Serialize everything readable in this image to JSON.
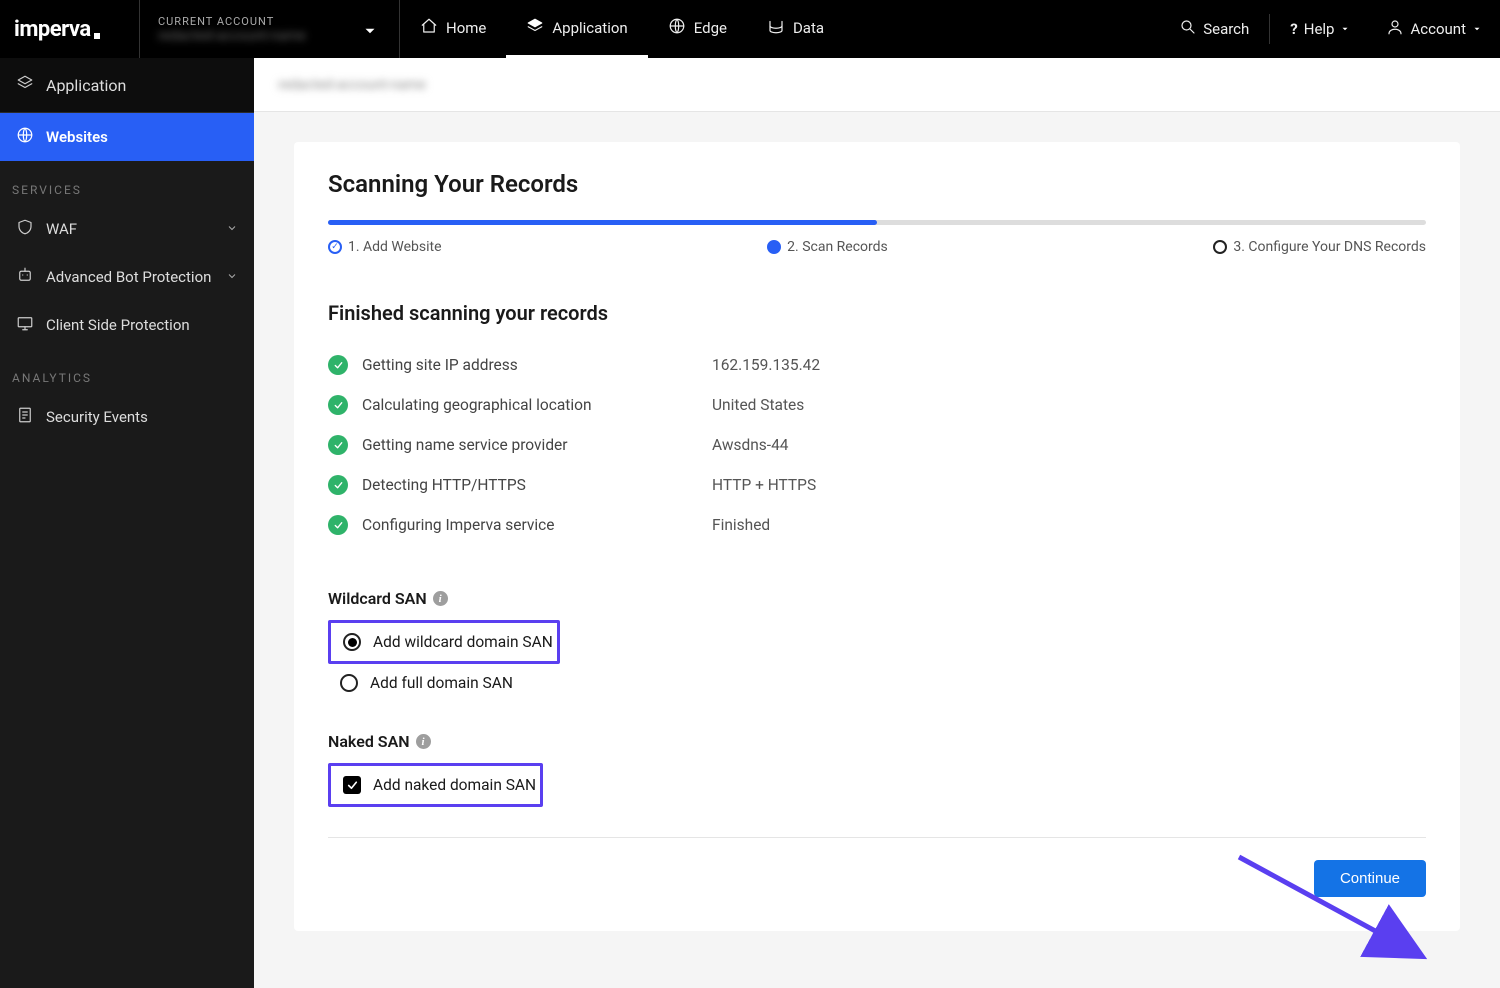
{
  "brand": "imperva",
  "account_selector": {
    "label": "CURRENT ACCOUNT",
    "value": "redacted-account-name"
  },
  "topnav": {
    "home": "Home",
    "application": "Application",
    "edge": "Edge",
    "data": "Data"
  },
  "topright": {
    "search": "Search",
    "help": "Help",
    "account": "Account"
  },
  "breadcrumb": "redacted-account-name",
  "sidebar": {
    "header": "Application",
    "websites": "Websites",
    "services_label": "SERVICES",
    "waf": "WAF",
    "abp": "Advanced Bot Protection",
    "csp": "Client Side Protection",
    "analytics_label": "ANALYTICS",
    "security_events": "Security Events"
  },
  "page": {
    "title": "Scanning Your Records",
    "steps": {
      "s1": "1. Add Website",
      "s2": "2. Scan Records",
      "s3": "3. Configure Your DNS Records"
    },
    "subtitle": "Finished scanning your records",
    "rows": [
      {
        "label": "Getting site IP address",
        "value": "162.159.135.42"
      },
      {
        "label": "Calculating geographical location",
        "value": "United States"
      },
      {
        "label": "Getting name service provider",
        "value": "Awsdns-44"
      },
      {
        "label": "Detecting HTTP/HTTPS",
        "value": "HTTP + HTTPS"
      },
      {
        "label": "Configuring Imperva service",
        "value": "Finished"
      }
    ],
    "wildcard": {
      "title": "Wildcard SAN",
      "opt_wild": "Add wildcard domain SAN",
      "opt_full": "Add full domain SAN"
    },
    "naked": {
      "title": "Naked SAN",
      "opt": "Add naked domain SAN"
    },
    "continue": "Continue"
  }
}
